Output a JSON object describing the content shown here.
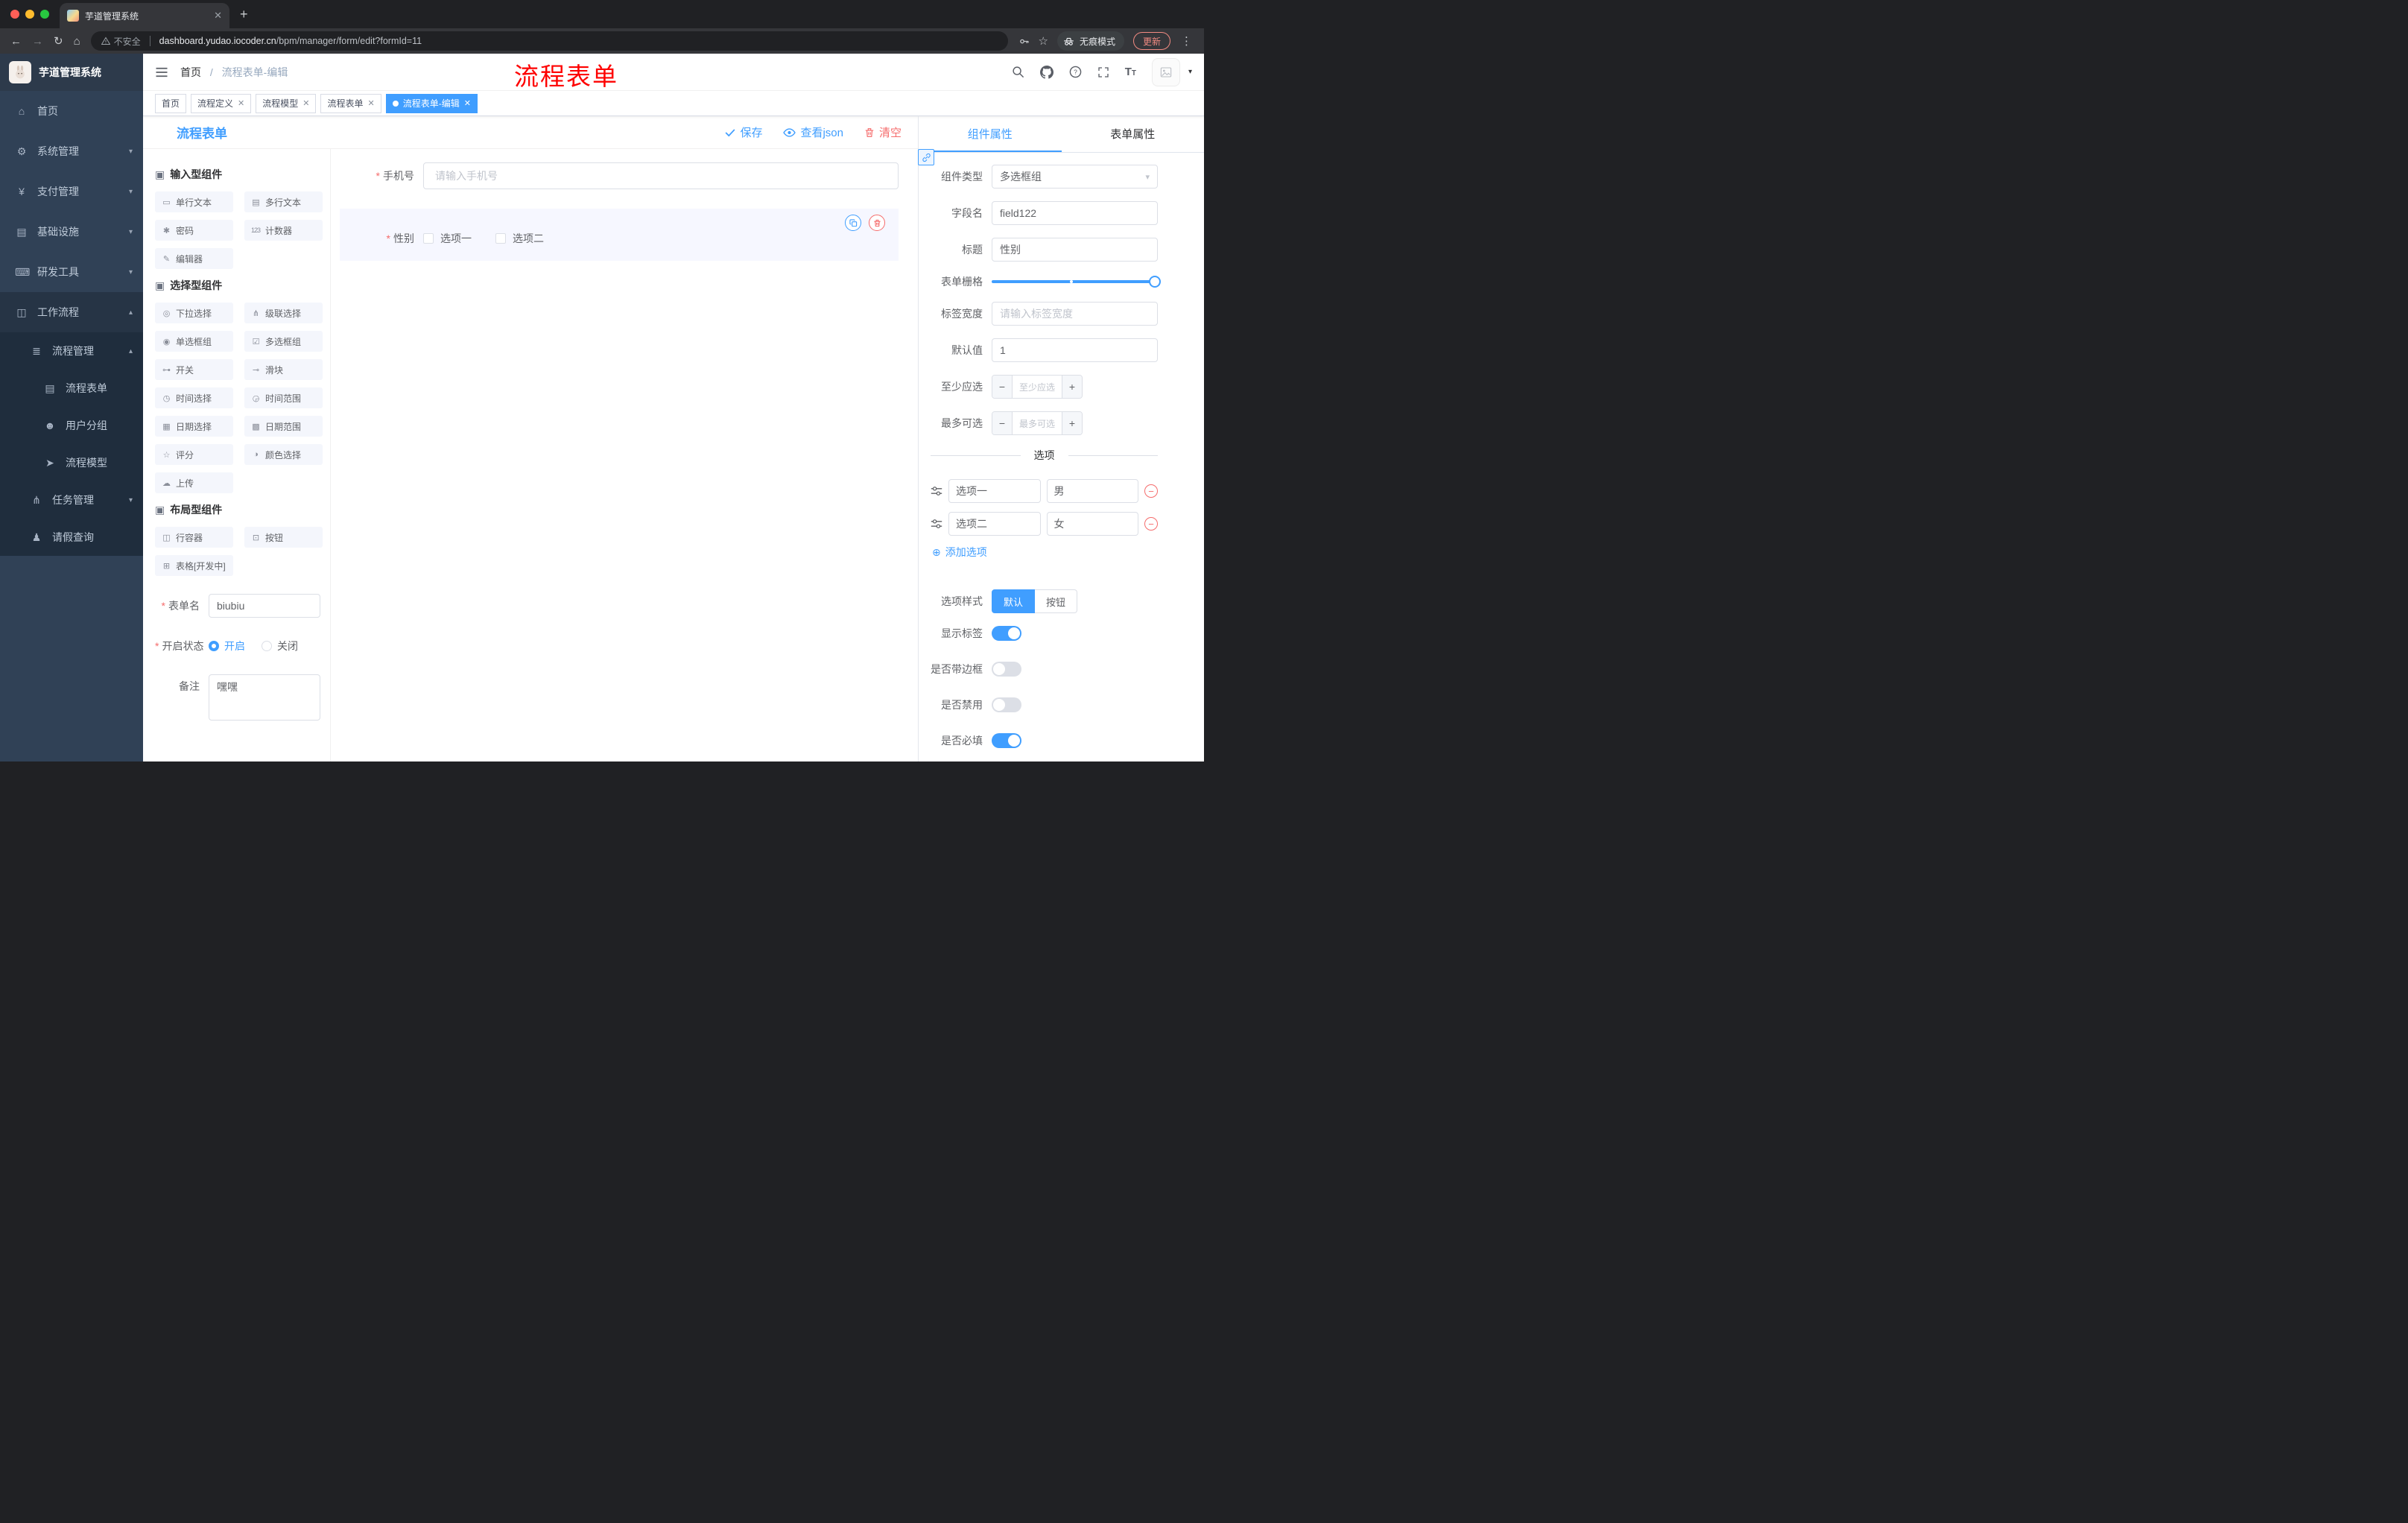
{
  "colors": {
    "primary": "#409eff",
    "danger": "#f56c6c",
    "annotation": "#fe0100",
    "sidebar_bg": "#304156",
    "submenu_bg": "#1f2d3d"
  },
  "browser": {
    "tab_title": "芋道管理系统",
    "security_label": "不安全",
    "url_domain": "dashboard.yudao.iocoder.cn",
    "url_path": "/bpm/manager/form/edit?formId=11",
    "incognito": "无痕模式",
    "update": "更新"
  },
  "sidebar": {
    "logo_title": "芋道管理系统",
    "items": [
      {
        "icon": "⌂",
        "label": "首页",
        "chevron": ""
      },
      {
        "icon": "⚙",
        "label": "系统管理",
        "chevron": "▾"
      },
      {
        "icon": "¥",
        "label": "支付管理",
        "chevron": "▾"
      },
      {
        "icon": "▤",
        "label": "基础设施",
        "chevron": "▾"
      },
      {
        "icon": "⌨",
        "label": "研发工具",
        "chevron": "▾"
      },
      {
        "icon": "◫",
        "label": "工作流程",
        "chevron": "▴"
      }
    ],
    "submenu": [
      {
        "icon": "≣",
        "label": "流程管理",
        "chevron": "▴"
      },
      {
        "icon": "▤",
        "label": "流程表单",
        "chevron": ""
      },
      {
        "icon": "☻",
        "label": "用户分组",
        "chevron": ""
      },
      {
        "icon": "➤",
        "label": "流程模型",
        "chevron": ""
      },
      {
        "icon": "⋔",
        "label": "任务管理",
        "chevron": "▾"
      },
      {
        "icon": "♟",
        "label": "请假查询",
        "chevron": ""
      }
    ]
  },
  "header": {
    "breadcrumb_home": "首页",
    "breadcrumb_sep": "/",
    "breadcrumb_current": "流程表单-编辑",
    "annotation": "流程表单"
  },
  "tags": [
    {
      "label": "首页"
    },
    {
      "label": "流程定义"
    },
    {
      "label": "流程模型"
    },
    {
      "label": "流程表单"
    },
    {
      "label": "流程表单-编辑"
    }
  ],
  "designer": {
    "title": "流程表单",
    "actions": {
      "save": "保存",
      "view_json": "查看json",
      "clear": "清空"
    },
    "palette": {
      "groups": [
        {
          "icon": "▣",
          "title": "输入型组件",
          "items": [
            {
              "icon": "▭",
              "label": "单行文本"
            },
            {
              "icon": "▤",
              "label": "多行文本"
            },
            {
              "icon": "✱",
              "label": "密码"
            },
            {
              "icon": "123",
              "label": "计数器"
            },
            {
              "icon": "✎",
              "label": "编辑器"
            }
          ]
        },
        {
          "icon": "▣",
          "title": "选择型组件",
          "items": [
            {
              "icon": "◎",
              "label": "下拉选择"
            },
            {
              "icon": "⋔",
              "label": "级联选择"
            },
            {
              "icon": "◉",
              "label": "单选框组"
            },
            {
              "icon": "☑",
              "label": "多选框组"
            },
            {
              "icon": "⊶",
              "label": "开关"
            },
            {
              "icon": "⊸",
              "label": "滑块"
            },
            {
              "icon": "◷",
              "label": "时间选择"
            },
            {
              "icon": "◶",
              "label": "时间范围"
            },
            {
              "icon": "▦",
              "label": "日期选择"
            },
            {
              "icon": "▩",
              "label": "日期范围"
            },
            {
              "icon": "☆",
              "label": "评分"
            },
            {
              "icon": "◑",
              "label": "颜色选择"
            },
            {
              "icon": "☁",
              "label": "上传"
            }
          ]
        },
        {
          "icon": "▣",
          "title": "布局型组件",
          "items": [
            {
              "icon": "◫",
              "label": "行容器"
            },
            {
              "icon": "⊡",
              "label": "按钮"
            },
            {
              "icon": "⊞",
              "label": "表格[开发中]"
            }
          ]
        }
      ]
    },
    "meta": {
      "form_name_label": "表单名",
      "form_name_value": "biubiu",
      "status_label": "开启状态",
      "status_on": "开启",
      "status_off": "关闭",
      "remark_label": "备注",
      "remark_value": "嘿嘿"
    },
    "canvas": {
      "phone_label": "手机号",
      "phone_placeholder": "请输入手机号",
      "gender_label": "性别",
      "gender_options": [
        "选项一",
        "选项二"
      ]
    }
  },
  "props": {
    "tab_component": "组件属性",
    "tab_form": "表单属性",
    "component_type_label": "组件类型",
    "component_type_value": "多选框组",
    "field_name_label": "字段名",
    "field_name_value": "field122",
    "title_label": "标题",
    "title_value": "性别",
    "grid_label": "表单栅格",
    "label_width_label": "标签宽度",
    "label_width_placeholder": "请输入标签宽度",
    "default_label": "默认值",
    "default_value": "1",
    "min_label": "至少应选",
    "min_placeholder": "至少应选",
    "max_label": "最多可选",
    "max_placeholder": "最多可选",
    "options_title": "选项",
    "options": [
      {
        "label": "选项一",
        "value": "男"
      },
      {
        "label": "选项二",
        "value": "女"
      }
    ],
    "add_option": "添加选项",
    "style_label": "选项样式",
    "style_default": "默认",
    "style_button": "按钮",
    "toggles": [
      {
        "label": "显示标签",
        "on": true
      },
      {
        "label": "是否带边框",
        "on": false
      },
      {
        "label": "是否禁用",
        "on": false
      },
      {
        "label": "是否必填",
        "on": true
      }
    ]
  }
}
